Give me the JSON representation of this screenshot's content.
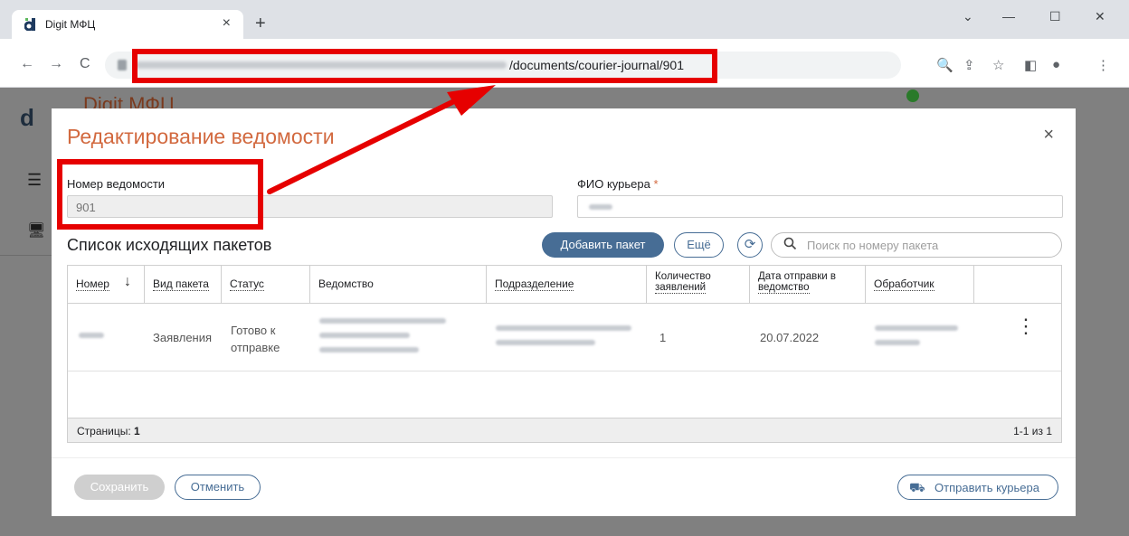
{
  "browser": {
    "tab_title": "Digit МФЦ",
    "tab_close": "×",
    "new_tab": "+",
    "url_visible_path": "/documents/courier-journal/901",
    "controls": {
      "minimize": "—",
      "maximize": "☐",
      "close": "✕",
      "dropdown": "⌄"
    },
    "nav": {
      "back": "←",
      "forward": "→",
      "reload": "C"
    },
    "toolbar_icons": {
      "zoom": "🔍",
      "share": "⇪",
      "bookmark": "☆",
      "sidepanel": "◧",
      "profile": "●",
      "menu": "⋮"
    }
  },
  "app": {
    "logo": "d",
    "title": "Digit МФЦ",
    "hamburger": "☰",
    "monitor": "🖥"
  },
  "modal": {
    "title": "Редактирование ведомости",
    "close": "×",
    "number_label": "Номер ведомости",
    "number_value": "901",
    "courier_label": "ФИО курьера",
    "required_mark": "*",
    "packets_title": "Список исходящих пакетов",
    "add_packet": "Добавить пакет",
    "more": "Ещё",
    "refresh": "⟳",
    "search_placeholder": "Поиск по номеру пакета",
    "table": {
      "headers": {
        "number": "Номер",
        "sort": "↓",
        "package_type": "Вид пакета",
        "status": "Статус",
        "department": "Ведомство",
        "subdivision": "Подразделение",
        "count_line1": "Количество",
        "count_line2": "заявлений",
        "date_line1": "Дата отправки в",
        "date_line2": "ведомство",
        "handler": "Обработчик"
      },
      "rows": [
        {
          "package_type": "Заявления",
          "status_line1": "Готово к",
          "status_line2": "отправке",
          "count": "1",
          "date": "20.07.2022",
          "actions": "⋮"
        }
      ],
      "pages_label": "Страницы:",
      "pages_value": "1",
      "range": "1-1 из 1"
    },
    "save": "Сохранить",
    "cancel": "Отменить",
    "send_courier": "Отправить курьера",
    "truck_icon": "⛟"
  },
  "annotation_color": "#e60000"
}
